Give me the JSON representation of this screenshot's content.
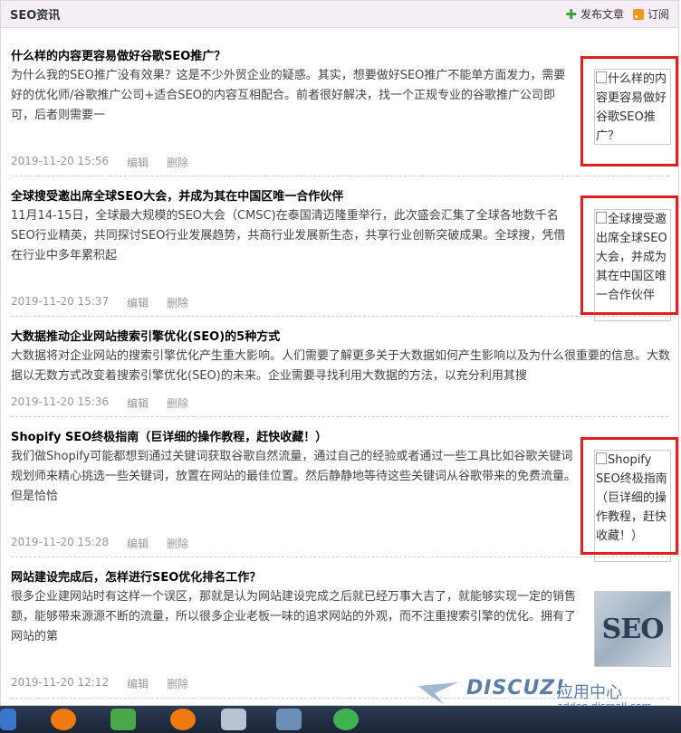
{
  "header": {
    "title": "SEO资讯",
    "publish_label": "发布文章",
    "subscribe_label": "订阅"
  },
  "articles": [
    {
      "title": "什么样的内容更容易做好谷歌SEO推广？",
      "summary": "为什么我的SEO推广没有效果？这是不少外贸企业的疑惑。其实，想要做好SEO推广不能单方面发力，需要好的优化师/谷歌推广公司+适合SEO的内容互相配合。前者很好解决，找一个正规专业的谷歌推广公司即可，后者则需要一",
      "date": "2019-11-20 15:56",
      "edit": "编辑",
      "delete": "删除",
      "thumb_alt": "什么样的内容更容易做好谷歌SEO推广？"
    },
    {
      "title": "全球搜受邀出席全球SEO大会，并成为其在中国区唯一合作伙伴",
      "summary": "11月14-15日，全球最大规模的SEO大会（CMSC)在泰国清迈隆重举行，此次盛会汇集了全球各地数千名SEO行业精英，共同探讨SEO行业发展趋势，共商行业发展新生态，共享行业创新突破成果。全球搜，凭借在行业中多年累积起",
      "date": "2019-11-20 15:37",
      "edit": "编辑",
      "delete": "删除",
      "thumb_alt": "全球搜受邀出席全球SEO大会，并成为其在中国区唯一合作伙伴"
    },
    {
      "title": "大数据推动企业网站搜索引擎优化(SEO)的5种方式",
      "summary": "大数据将对企业网站的搜索引擎优化产生重大影响。人们需要了解更多关于大数据如何产生影响以及为什么很重要的信息。大数据以无数方式改变着搜索引擎优化(SEO)的未来。企业需要寻找利用大数据的方法，以充分利用其搜",
      "date": "2019-11-20 15:36",
      "edit": "编辑",
      "delete": "删除"
    },
    {
      "title": "Shopify SEO终极指南（巨详细的操作教程，赶快收藏！）",
      "summary": "我们做Shopify可能都想到通过关键词获取谷歌自然流量，通过自己的经验或者通过一些工具比如谷歌关键词规划师来精心挑选一些关键词，放置在网站的最佳位置。然后静静地等待这些关键词从谷歌带来的免费流量。但是恰恰",
      "date": "2019-11-20 15:28",
      "edit": "编辑",
      "delete": "删除",
      "thumb_alt": "Shopify SEO终极指南（巨详细的操作教程，赶快收藏！）"
    },
    {
      "title": "网站建设完成后，怎样进行SEO优化排名工作？",
      "summary": "很多企业建网站时有这样一个误区，那就是认为网站建设完成之后就已经万事大吉了，就能够实现一定的销售额，能够带来源源不断的流量，所以很多企业老板一味的追求网站的外观，而不注重搜索引擎的优化。拥有了网站的第",
      "date": "2019-11-20 12:12",
      "edit": "编辑",
      "delete": "删除",
      "thumb_text": "SEO"
    }
  ],
  "watermark": {
    "brand": "DISCUZ!",
    "sub": "应用中心",
    "url": "addon.dismall.com"
  },
  "colors": {
    "header_bg": "#f5eef7",
    "highlight_border": "#e02020",
    "watermark": "#5a7ea8"
  }
}
